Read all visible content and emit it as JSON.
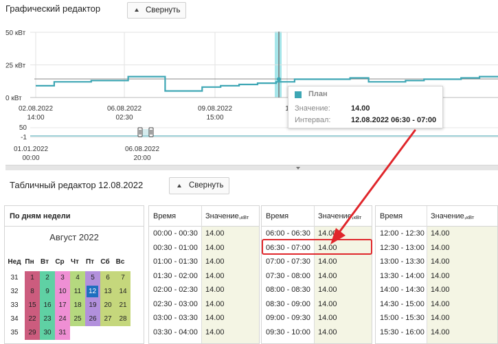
{
  "graph_editor": {
    "title": "Графический редактор",
    "collapse_label": "Свернуть"
  },
  "table_editor": {
    "title": "Табличный редактор 12.08.2022",
    "collapse_label": "Свернуть"
  },
  "chart_data": {
    "type": "line",
    "y_ticks": [
      "50 кВт",
      "25 кВт",
      "0 кВт"
    ],
    "ylim": [
      0,
      50
    ],
    "x_tick_labels": [
      {
        "date": "02.08.2022",
        "time": "14:00"
      },
      {
        "date": "06.08.2022",
        "time": "02:30"
      },
      {
        "date": "09.08.2022",
        "time": "15:00"
      },
      {
        "date": "1",
        "time": ""
      }
    ],
    "series": [
      {
        "name": "План",
        "color": "#3da6b4",
        "values": [
          9,
          12,
          12,
          13,
          13,
          16,
          16,
          5,
          5,
          8,
          9,
          10,
          11,
          12,
          14,
          14,
          14,
          15,
          12,
          12,
          13,
          14,
          14,
          15,
          16
        ]
      }
    ],
    "highlight": {
      "series": "План",
      "value": "14.00",
      "interval": "12.08.2022 06:30 - 07:00"
    },
    "grid": true
  },
  "navigator": {
    "y_ticks": [
      "50",
      "-1"
    ],
    "x_tick_labels": [
      {
        "date": "01.01.2022",
        "time": "00:00"
      },
      {
        "date": "06.08.2022",
        "time": "20:00"
      }
    ]
  },
  "tooltip": {
    "series": "План",
    "value_label": "Значение:",
    "value": "14.00",
    "interval_label": "Интервал:",
    "interval": "12.08.2022 06:30 - 07:00"
  },
  "calendar": {
    "header": "По дням недели",
    "month": "Август 2022",
    "weekdays": [
      "Нед",
      "Пн",
      "Вт",
      "Ср",
      "Чт",
      "Пт",
      "Сб",
      "Вс"
    ],
    "rows": [
      {
        "week": "31",
        "days": [
          "1",
          "2",
          "3",
          "4",
          "5",
          "6",
          "7"
        ]
      },
      {
        "week": "32",
        "days": [
          "8",
          "9",
          "10",
          "11",
          "12",
          "13",
          "14"
        ]
      },
      {
        "week": "33",
        "days": [
          "15",
          "16",
          "17",
          "18",
          "19",
          "20",
          "21"
        ]
      },
      {
        "week": "34",
        "days": [
          "22",
          "23",
          "24",
          "25",
          "26",
          "27",
          "28"
        ]
      },
      {
        "week": "35",
        "days": [
          "29",
          "30",
          "31"
        ]
      }
    ],
    "weekday_colors": [
      "#cc5c7e",
      "#5fd1a4",
      "#ef8fd4",
      "#b5d97f",
      "#b290dc",
      "#c5d77c",
      "#c5d77c"
    ],
    "selected_day": "12",
    "selected_color": "#1e6fbf"
  },
  "tables": {
    "time_header": "Время",
    "value_header": "Значение,",
    "value_unit": "кВт",
    "col1": [
      {
        "time": "00:00 - 00:30",
        "value": "14.00"
      },
      {
        "time": "00:30 - 01:00",
        "value": "14.00"
      },
      {
        "time": "01:00 - 01:30",
        "value": "14.00"
      },
      {
        "time": "01:30 - 02:00",
        "value": "14.00"
      },
      {
        "time": "02:00 - 02:30",
        "value": "14.00"
      },
      {
        "time": "02:30 - 03:00",
        "value": "14.00"
      },
      {
        "time": "03:00 - 03:30",
        "value": "14.00"
      },
      {
        "time": "03:30 - 04:00",
        "value": "14.00"
      }
    ],
    "col2": [
      {
        "time": "06:00 - 06:30",
        "value": "14.00"
      },
      {
        "time": "06:30 - 07:00",
        "value": "14.00"
      },
      {
        "time": "07:00 - 07:30",
        "value": "14.00"
      },
      {
        "time": "07:30 - 08:00",
        "value": "14.00"
      },
      {
        "time": "08:00 - 08:30",
        "value": "14.00"
      },
      {
        "time": "08:30 - 09:00",
        "value": "14.00"
      },
      {
        "time": "09:00 - 09:30",
        "value": "14.00"
      },
      {
        "time": "09:30 - 10:00",
        "value": "14.00"
      }
    ],
    "col3": [
      {
        "time": "12:00 - 12:30",
        "value": "14.00"
      },
      {
        "time": "12:30 - 13:00",
        "value": "14.00"
      },
      {
        "time": "13:00 - 13:30",
        "value": "14.00"
      },
      {
        "time": "13:30 - 14:00",
        "value": "14.00"
      },
      {
        "time": "14:00 - 14:30",
        "value": "14.00"
      },
      {
        "time": "14:30 - 15:00",
        "value": "14.00"
      },
      {
        "time": "15:00 - 15:30",
        "value": "14.00"
      },
      {
        "time": "15:30 - 16:00",
        "value": "14.00"
      }
    ],
    "highlighted_row": "06:30 - 07:00"
  },
  "colors": {
    "accent": "#3da6b4",
    "highlight_band": "#a6e6ea",
    "annotation": "#e0262b"
  }
}
